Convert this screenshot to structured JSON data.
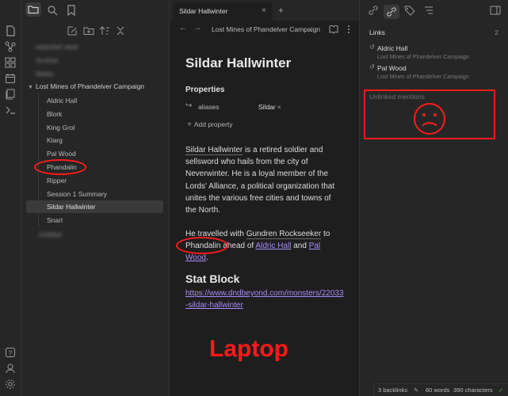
{
  "ribbon": {
    "icons": [
      "open-vault-icon",
      "graph-view-icon",
      "canvas-icon",
      "daily-note-icon",
      "templates-icon",
      "command-palette-icon"
    ],
    "bottom_icons": [
      "help-icon",
      "vault-icon",
      "settings-icon"
    ]
  },
  "explorer": {
    "top_icons": [
      "folder-icon",
      "search-icon",
      "bookmark-icon"
    ],
    "actions": [
      "new-note-icon",
      "new-folder-icon",
      "sort-icon",
      "collapse-icon"
    ],
    "blurred_items": [
      "redacted vault",
      "Archive",
      "Notes"
    ],
    "folder_label": "Lost Mines of Phandelver Campaign",
    "items": [
      "Aldric Hall",
      "Blork",
      "King Grol",
      "Klarg",
      "Pal Wood",
      "Phandalin",
      "Ripper",
      "Session 1 Summary",
      "Sildar Hallwinter",
      "Snarl"
    ],
    "blurred_after": [
      "Untitled"
    ],
    "selected_item": "Sildar Hallwinter"
  },
  "tabs": [
    {
      "label": "Sildar Hallwinter",
      "close": "×"
    }
  ],
  "new_tab": "+",
  "nav": {
    "back": "←",
    "forward": "→",
    "title": "Lost Mines of Phandelver Campaign"
  },
  "note": {
    "title": "Sildar Hallwinter",
    "properties_heading": "Properties",
    "property_key": "aliases",
    "property_value": "Sildar",
    "property_remove": "×",
    "add_property": "Add property",
    "p1": {
      "name": "Sildar Hallwinter",
      "rest": " is a retired soldier and sellsword who hails from the city of Neverwinter. He is a loyal member of the Lords' Alliance, a political organization that unites the various free cities and towns of the North."
    },
    "p2": {
      "a": "He travelled with ",
      "gundren": "Gundren Rockseeker",
      "b": " to ",
      "phandalin": "Phandalin",
      "c": " ahead of ",
      "link1": "Aldric Hall",
      "d": " and ",
      "link2": "Pal Wood",
      "e": "."
    },
    "h2": "Stat Block",
    "url": "https://www.dndbeyond.com/monsters/22033-sildar-hallwinter"
  },
  "annotation_text": "Laptop",
  "links_panel": {
    "title": "Links",
    "count": "2",
    "items": [
      {
        "name": "Aldric Hall",
        "sub": "Lost Mines of Phandelver Campaign"
      },
      {
        "name": "Pal Wood",
        "sub": "Lost Mines of Phandelver Campaign"
      }
    ],
    "unlinked": "Unlinked mentions"
  },
  "status": {
    "backlinks": "3 backlinks",
    "words": "60 words",
    "chars": "390 characters"
  },
  "colors": {
    "accent_link": "#a88bfa",
    "annotation_red": "#ff1a1a"
  }
}
